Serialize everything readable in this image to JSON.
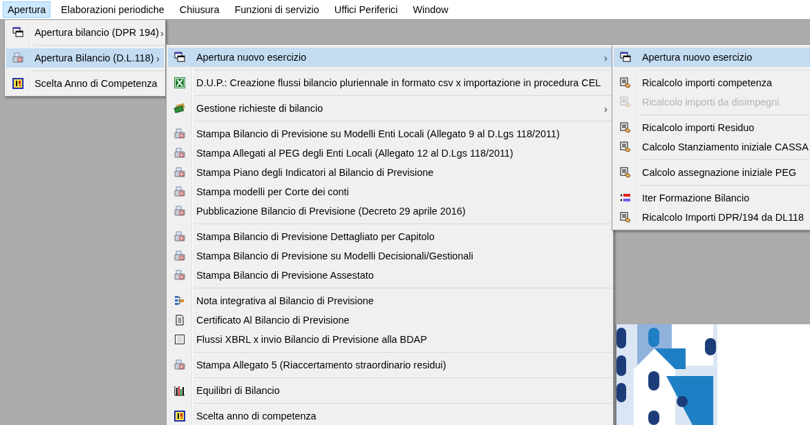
{
  "menubar": [
    {
      "label": "Apertura",
      "selected": true
    },
    {
      "label": "Elaborazioni periodiche",
      "selected": false
    },
    {
      "label": "Chiusura",
      "selected": false
    },
    {
      "label": "Funzioni di servizio",
      "selected": false
    },
    {
      "label": "Uffici Periferici",
      "selected": false
    },
    {
      "label": "Window",
      "selected": false
    }
  ],
  "menu": {
    "groups": [
      {
        "items": [
          {
            "kind": "windows",
            "label": "Apertura bilancio (DPR 194)",
            "arrow": "›",
            "selected": false,
            "disabled": false
          }
        ]
      },
      {
        "items": [
          {
            "kind": "printer",
            "label": "Apertura Bilancio (D.L.118)",
            "arrow": "›",
            "selected": true,
            "disabled": false
          }
        ]
      },
      {
        "items": [
          {
            "kind": "year",
            "label": "Scelta Anno di Competenza",
            "selected": false,
            "disabled": false
          }
        ]
      }
    ]
  },
  "submenu": {
    "groups": [
      {
        "items": [
          {
            "kind": "windows",
            "label": "Apertura nuovo esercizio",
            "arrow": "›",
            "selected": true,
            "disabled": false
          }
        ]
      },
      {
        "items": [
          {
            "kind": "sheet",
            "label": "D.U.P.: Creazione flussi bilancio pluriennale in formato csv x importazione in procedura CEL",
            "selected": false,
            "disabled": false
          }
        ]
      },
      {
        "items": [
          {
            "kind": "money",
            "label": "Gestione richieste di bilancio",
            "arrow": "›",
            "selected": false,
            "disabled": false
          }
        ]
      },
      {
        "items": [
          {
            "kind": "printer",
            "label": "Stampa Bilancio di Previsione su Modelli Enti Locali (Allegato 9 al D.Lgs 118/2011)",
            "selected": false,
            "disabled": false
          },
          {
            "kind": "printer",
            "label": "Stampa Allegati al PEG degli Enti Locali (Allegato 12 al D.Lgs 118/2011)",
            "selected": false,
            "disabled": false
          },
          {
            "kind": "printer",
            "label": "Stampa Piano degli Indicatori al Bilancio di Previsione",
            "selected": false,
            "disabled": false
          },
          {
            "kind": "printer",
            "label": "Stampa modelli per Corte dei conti",
            "selected": false,
            "disabled": false
          },
          {
            "kind": "printer",
            "label": "Pubblicazione Bilancio di Previsione (Decreto 29 aprile 2016)",
            "selected": false,
            "disabled": false
          }
        ]
      },
      {
        "items": [
          {
            "kind": "printer",
            "label": "Stampa Bilancio di Previsione Dettagliato per Capitolo",
            "selected": false,
            "disabled": false
          },
          {
            "kind": "printer",
            "label": "Stampa Bilancio di Previsione su Modelli Decisionali/Gestionali",
            "selected": false,
            "disabled": false
          },
          {
            "kind": "printer",
            "label": "Stampa Bilancio di Previsione Assestato",
            "selected": false,
            "disabled": false
          }
        ]
      },
      {
        "items": [
          {
            "kind": "tree",
            "label": "Nota integrativa al Bilancio di Previsione",
            "selected": false,
            "disabled": false
          },
          {
            "kind": "document",
            "label": "Certificato Al Bilancio di Previsione",
            "selected": false,
            "disabled": false
          },
          {
            "kind": "table",
            "label": "Flussi XBRL x invio Bilancio di Previsione alla BDAP",
            "selected": false,
            "disabled": false
          }
        ]
      },
      {
        "items": [
          {
            "kind": "printer",
            "label": "Stampa Allegato 5 (Riaccertamento straordinario residui)",
            "selected": false,
            "disabled": false
          }
        ]
      },
      {
        "items": [
          {
            "kind": "chart",
            "label": "Equilibri di Bilancio",
            "selected": false,
            "disabled": false
          }
        ]
      },
      {
        "items": [
          {
            "kind": "year",
            "label": "Scelta anno di competenza",
            "selected": false,
            "disabled": false
          }
        ]
      }
    ]
  },
  "submenu2": {
    "groups": [
      {
        "items": [
          {
            "kind": "windows",
            "label": "Apertura nuovo esercizio",
            "selected": true,
            "disabled": false
          }
        ]
      },
      {
        "items": [
          {
            "kind": "calc",
            "label": "Ricalcolo importi competenza",
            "selected": false,
            "disabled": false
          },
          {
            "kind": "calc",
            "label": "Ricalcolo importi da disimpegni",
            "selected": false,
            "disabled": true
          }
        ]
      },
      {
        "items": [
          {
            "kind": "calc",
            "label": "Ricalcolo importi Residuo",
            "selected": false,
            "disabled": false
          },
          {
            "kind": "calc",
            "label": "Calcolo Stanziamento iniziale CASSA",
            "selected": false,
            "disabled": false
          }
        ]
      },
      {
        "items": [
          {
            "kind": "calc",
            "label": "Calcolo assegnazione iniziale PEG",
            "selected": false,
            "disabled": false
          }
        ]
      },
      {
        "items": [
          {
            "kind": "list",
            "label": "Iter Formazione Bilancio",
            "selected": false,
            "disabled": false
          },
          {
            "kind": "calc",
            "label": "Ricalcolo Importi DPR/194 da DL118",
            "selected": false,
            "disabled": false
          }
        ]
      }
    ]
  }
}
